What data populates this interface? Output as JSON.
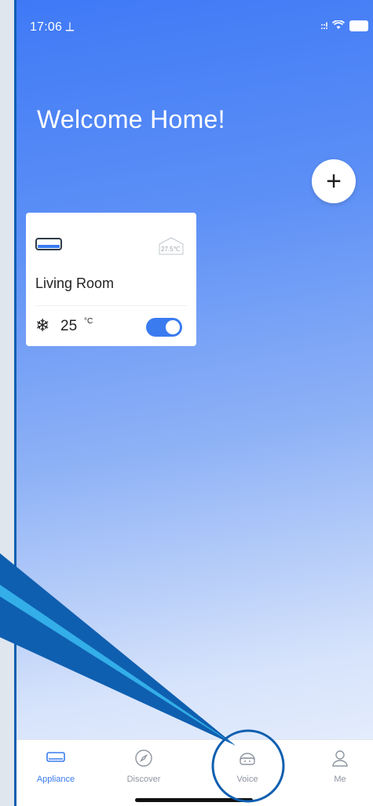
{
  "status_bar": {
    "time": "17:06 ⟂",
    "signal": "::!",
    "wifi": "wifi-icon",
    "battery": "battery-icon"
  },
  "header": {
    "title": "Welcome Home!"
  },
  "add_button": {
    "label": "+"
  },
  "devices": [
    {
      "name": "Living Room",
      "room_temperature": "27.5℃",
      "mode_icon": "snowflake-icon",
      "set_temperature": "25",
      "unit": "°C",
      "power": true
    }
  ],
  "tab_bar": {
    "tabs": [
      {
        "label": "Appliance",
        "icon": "appliance-icon",
        "active": true
      },
      {
        "label": "Discover",
        "icon": "compass-icon",
        "active": false
      },
      {
        "label": "Voice",
        "icon": "voice-icon",
        "active": false
      },
      {
        "label": "Me",
        "icon": "person-icon",
        "active": false
      }
    ]
  },
  "colors": {
    "accent": "#3a7bf0",
    "annotation": "#0f5fb0"
  }
}
